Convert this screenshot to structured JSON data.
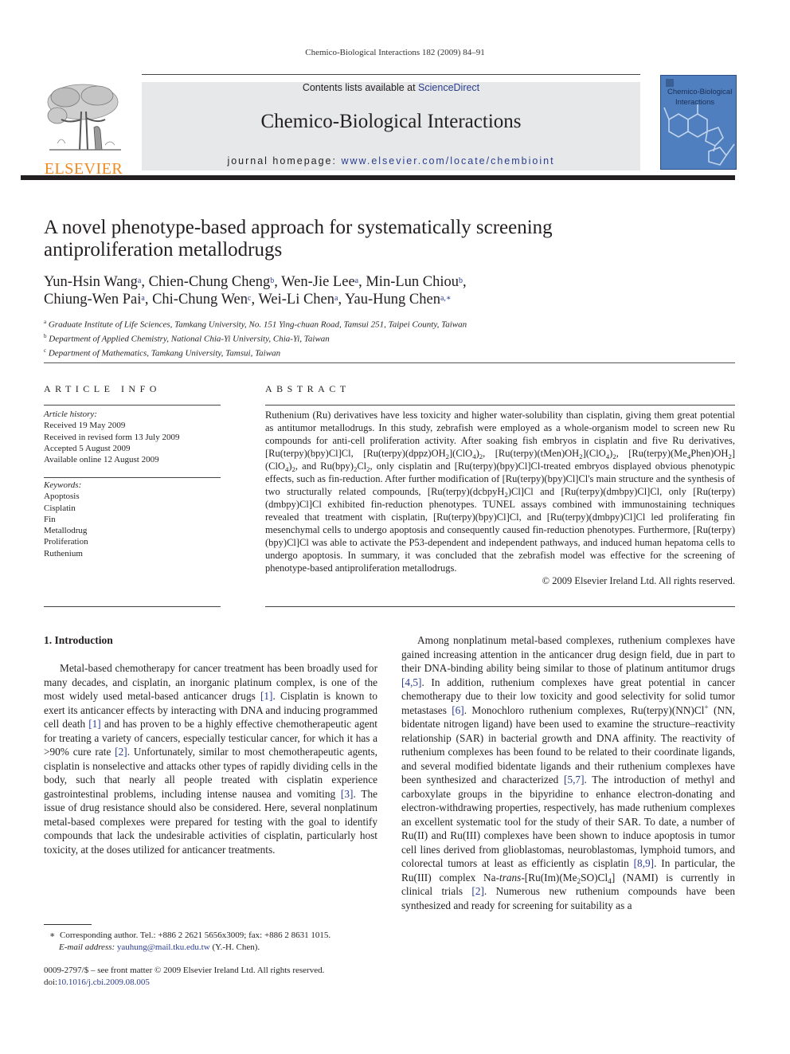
{
  "running_head": "Chemico-Biological Interactions 182 (2009) 84–91",
  "masthead": {
    "publisher_logo": "ELSEVIER",
    "contents_prefix": "Contents lists available at ",
    "contents_link": "ScienceDirect",
    "journal_name": "Chemico-Biological Interactions",
    "homepage_prefix": "journal homepage: ",
    "homepage_url": "www.elsevier.com/locate/chembioint",
    "cover_title_line1": "Chemico-Biological",
    "cover_title_line2": "Interactions",
    "colors": {
      "logo_orange": "#f18a21",
      "band_gray": "#e7e8e9",
      "link_blue": "#2b3d8f",
      "cover_blue": "#4f7fbf"
    }
  },
  "article": {
    "title_line1": "A novel phenotype-based approach for systematically screening",
    "title_line2": "antiproliferation metallodrugs",
    "authors": [
      {
        "name": "Yun-Hsin Wang",
        "sup": "a",
        "sep": ", "
      },
      {
        "name": "Chien-Chung Cheng",
        "sup": "b",
        "sep": ", "
      },
      {
        "name": "Wen-Jie Lee",
        "sup": "a",
        "sep": ", "
      },
      {
        "name": "Min-Lun Chiou",
        "sup": "b",
        "sep": ","
      },
      {
        "name": "Chiung-Wen Pai",
        "sup": "a",
        "sep": ", "
      },
      {
        "name": "Chi-Chung Wen",
        "sup": "c",
        "sep": ", "
      },
      {
        "name": "Wei-Li Chen",
        "sup": "a",
        "sep": ", "
      },
      {
        "name": "Yau-Hung Chen",
        "sup": "a,∗",
        "sep": ""
      }
    ],
    "affiliations": [
      {
        "key": "a",
        "text": "Graduate Institute of Life Sciences, Tamkang University, No. 151 Ying-chuan Road, Tamsui 251, Taipei County, Taiwan"
      },
      {
        "key": "b",
        "text": "Department of Applied Chemistry, National Chia-Yi University, Chia-Yi, Taiwan"
      },
      {
        "key": "c",
        "text": "Department of Mathematics, Tamkang University, Tamsui, Taiwan"
      }
    ]
  },
  "article_info": {
    "heading": "ARTICLE INFO",
    "history_label": "Article history:",
    "history": [
      "Received 19 May 2009",
      "Received in revised form 13 July 2009",
      "Accepted 5 August 2009",
      "Available online 12 August 2009"
    ],
    "keywords_label": "Keywords:",
    "keywords": [
      "Apoptosis",
      "Cisplatin",
      "Fin",
      "Metallodrug",
      "Proliferation",
      "Ruthenium"
    ]
  },
  "abstract": {
    "heading": "ABSTRACT",
    "text_html": "Ruthenium (Ru) derivatives have less toxicity and higher water-solubility than cisplatin, giving them great potential as antitumor metallodrugs. In this study, zebrafish were employed as a whole-organism model to screen new Ru compounds for anti-cell proliferation activity. After soaking fish embryos in cisplatin and five Ru derivatives, [Ru(terpy)(bpy)Cl]Cl, [Ru(terpy)(dppz)OH<sub>2</sub>](ClO<sub>4</sub>)<sub>2</sub>, [Ru(terpy)(tMen)OH<sub>2</sub>](ClO<sub>4</sub>)<sub>2</sub>, [Ru(terpy)(Me<sub>4</sub>Phen)OH<sub>2</sub>](ClO<sub>4</sub>)<sub>2</sub>, and Ru(bpy)<sub>2</sub>Cl<sub>2</sub>, only cisplatin and [Ru(terpy)(bpy)Cl]Cl-treated embryos displayed obvious phenotypic effects, such as fin-reduction. After further modification of [Ru(terpy)(bpy)Cl]Cl's main structure and the synthesis of two structurally related compounds, [Ru(terpy)(dcbpyH<sub>2</sub>)Cl]Cl and [Ru(terpy)(dmbpy)Cl]Cl, only [Ru(terpy)(dmbpy)Cl]Cl exhibited fin-reduction phenotypes. TUNEL assays combined with immunostaining techniques revealed that treatment with cisplatin, [Ru(terpy)(bpy)Cl]Cl, and [Ru(terpy)(dmbpy)Cl]Cl led proliferating fin mesenchymal cells to undergo apoptosis and consequently caused fin-reduction phenotypes. Furthermore, [Ru(terpy)(bpy)Cl]Cl was able to activate the P53-dependent and independent pathways, and induced human hepatoma cells to undergo apoptosis. In summary, it was concluded that the zebrafish model was effective for the screening of phenotype-based antiproliferation metallodrugs.",
    "copyright": "© 2009 Elsevier Ireland Ltd. All rights reserved."
  },
  "intro": {
    "heading": "1.  Introduction",
    "para1_html": "Metal-based chemotherapy for cancer treatment has been broadly used for many decades, and cisplatin, an inorganic platinum complex, is one of the most widely used metal-based anticancer drugs <span class='link'>[1]</span>. Cisplatin is known to exert its anticancer effects by interacting with DNA and inducing programmed cell death <span class='link'>[1]</span> and has proven to be a highly effective chemotherapeutic agent for treating a variety of cancers, especially testicular cancer, for which it has a &gt;90% cure rate <span class='link'>[2]</span>. Unfortunately, similar to most chemotherapeutic agents, cisplatin is nonselective and attacks other types of rapidly dividing cells in the body, such that nearly all people treated with cisplatin experience gastrointestinal problems, including intense nausea and vomiting <span class='link'>[3]</span>. The issue of drug resistance should also be considered. Here, several nonplatinum metal-based complexes were prepared for testing with the goal to identify compounds that lack the undesirable activities of cisplatin, particularly host toxicity, at the doses utilized for anticancer treatments.",
    "para2_html": "Among nonplatinum metal-based complexes, ruthenium complexes have gained increasing attention in the anticancer drug design field, due in part to their DNA-binding ability being similar to those of platinum antitumor drugs <span class='link'>[4,5]</span>. In addition, ruthenium complexes have great potential in cancer chemotherapy due to their low toxicity and good selectivity for solid tumor metastases <span class='link'>[6]</span>. Monochloro ruthenium complexes, Ru(terpy)(NN)Cl<sup class='sm'>+</sup> (NN, bidentate nitrogen ligand) have been used to examine the structure–reactivity relationship (SAR) in bacterial growth and DNA affinity. The reactivity of ruthenium complexes has been found to be related to their coordinate ligands, and several modified bidentate ligands and their ruthenium complexes have been synthesized and characterized <span class='link'>[5,7]</span>. The introduction of methyl and carboxylate groups in the bipyridine to enhance electron-donating and electron-withdrawing properties, respectively, has made ruthenium complexes an excellent systematic tool for the study of their SAR. To date, a number of Ru(II) and Ru(III) complexes have been shown to induce apoptosis in tumor cell lines derived from glioblastomas, neuroblastomas, lymphoid tumors, and colorectal tumors at least as efficiently as cisplatin <span class='link'>[8,9]</span>. In particular, the Ru(III) complex Na-<i>trans</i>-[Ru(Im)(Me<sub>2</sub>SO)Cl<sub>4</sub>] (NAMI) is currently in clinical trials <span class='link'>[2]</span>. Numerous new ruthenium compounds have been synthesized and ready for screening for suitability as a"
  },
  "footnote": {
    "marker": "∗",
    "corresponding": "Corresponding author. Tel.: +886 2 2621 5656x3009; fax: +886 2 8631 1015.",
    "email_label": "E-mail address:",
    "email": "yauhung@mail.tku.edu.tw",
    "email_suffix": " (Y.-H. Chen)."
  },
  "front_matter": {
    "issn_line": "0009-2797/$ – see front matter © 2009 Elsevier Ireland Ltd. All rights reserved.",
    "doi_prefix": "doi:",
    "doi": "10.1016/j.cbi.2009.08.005"
  }
}
